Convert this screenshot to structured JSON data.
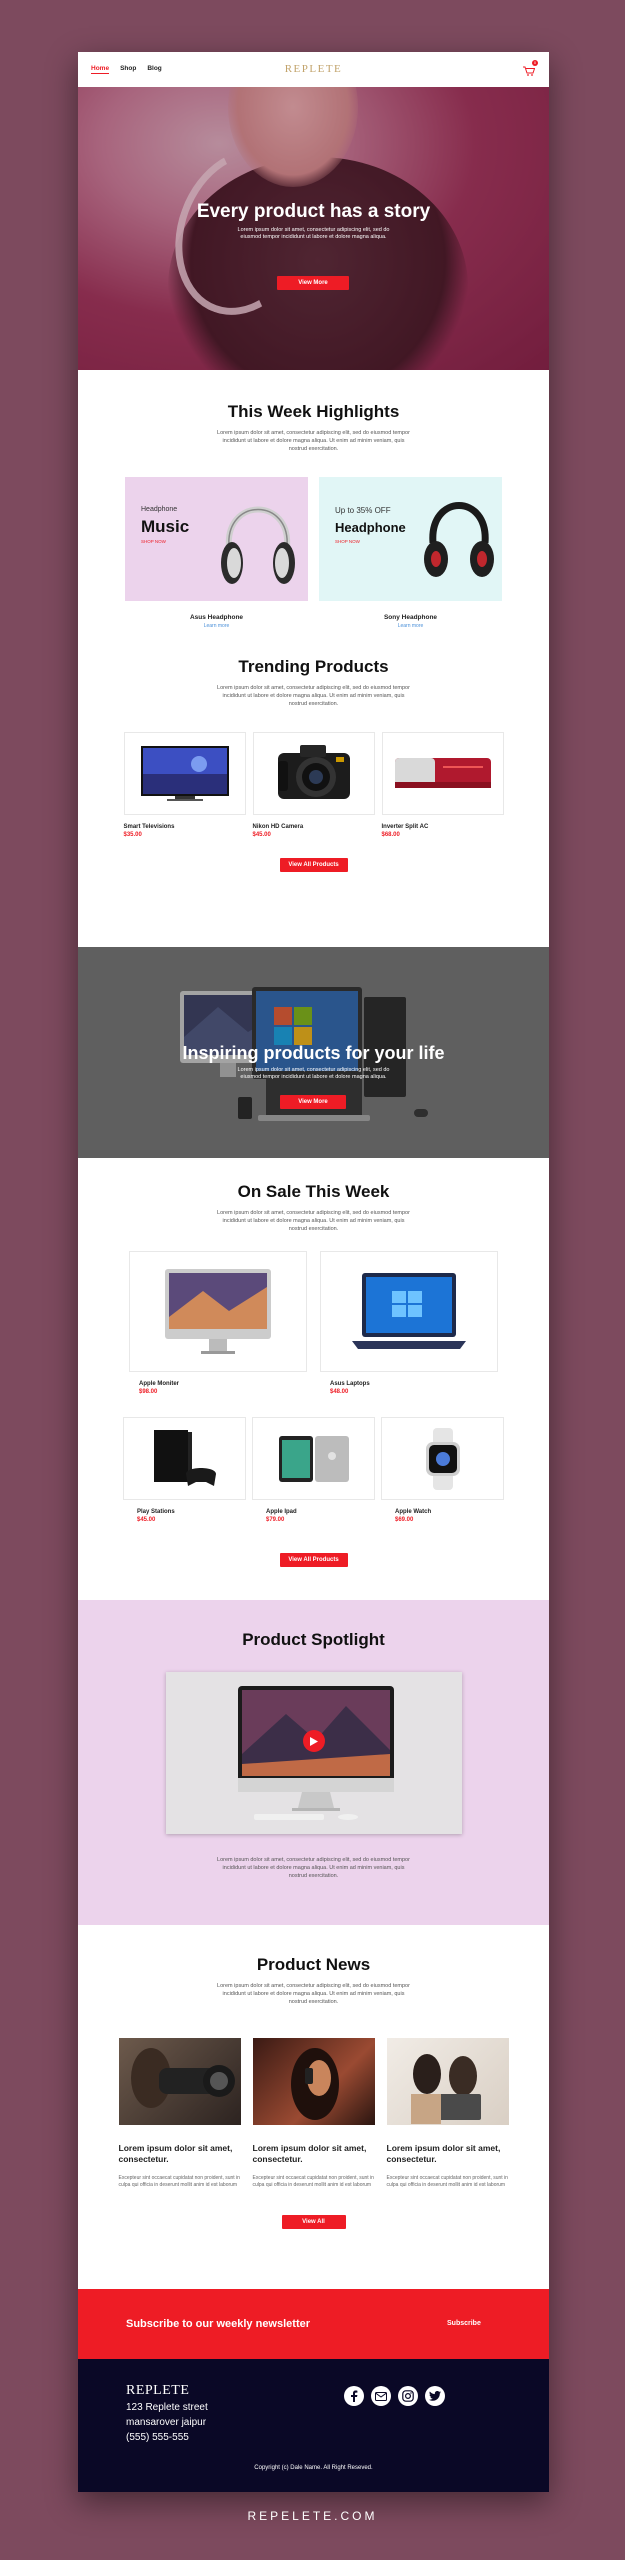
{
  "nav": {
    "links": [
      "Home",
      "Shop",
      "Blog"
    ],
    "logo": "REPLETE",
    "cart_count": "0"
  },
  "hero": {
    "title": "Every product has a story",
    "desc": "Lorem ipsum dolor sit amet, consectetur adipiscing elit, sed do eiusmod tempor incididunt ut labore et dolore magna aliqua.",
    "button": "View More"
  },
  "highlights": {
    "title": "This Week Highlights",
    "desc": "Lorem ipsum dolor sit amet, consectetur adipiscing elit, sed do eiusmod tempor incididunt ut labore et dolore magna aliqua. Ut enim ad minim veniam, quis nostrud exercitation.",
    "cards": [
      {
        "small": "Headphone",
        "big": "Music",
        "shop": "SHOP NOW",
        "name": "Asus Headphone",
        "link": "Learn more",
        "bg": "#ecd3ec"
      },
      {
        "small": "Up to 35% OFF",
        "big": "Headphone",
        "shop": "SHOP NOW",
        "name": "Sony Headphone",
        "link": "Learn more",
        "bg": "#e1f6f6"
      }
    ]
  },
  "trending": {
    "title": "Trending Products",
    "desc": "Lorem ipsum dolor sit amet, consectetur adipiscing elit, sed do eiusmod tempor incididunt ut labore et dolore magna aliqua. Ut enim ad minim veniam, quis nostrud exercitation.",
    "items": [
      {
        "name": "Smart Televisions",
        "price": "$35.00"
      },
      {
        "name": "Nikon HD Camera",
        "price": "$45.00"
      },
      {
        "name": "Inverter Split AC",
        "price": "$68.00"
      }
    ],
    "button": "View All Products"
  },
  "inspire": {
    "title": "Inspiring products for your life",
    "desc": "Lorem ipsum dolor sit amet, consectetur adipiscing elit, sed do eiusmod tempor incididunt ut labore et dolore magna aliqua.",
    "button": "View More"
  },
  "sale": {
    "title": "On Sale This Week",
    "desc": "Lorem ipsum dolor sit amet, consectetur adipiscing elit, sed do eiusmod tempor incididunt ut labore et dolore magna aliqua. Ut enim ad minim veniam, quis nostrud exercitation.",
    "big": [
      {
        "name": "Apple Moniter",
        "price": "$98.00"
      },
      {
        "name": "Asus Laptops",
        "price": "$48.00"
      }
    ],
    "small": [
      {
        "name": "Play Stations",
        "price": "$45.00"
      },
      {
        "name": "Apple Ipad",
        "price": "$79.00"
      },
      {
        "name": "Apple Watch",
        "price": "$69.00"
      }
    ],
    "button": "View All Products"
  },
  "spotlight": {
    "title": "Product Spotlight",
    "desc": "Lorem ipsum dolor sit amet, consectetur adipiscing elit, sed do eiusmod tempor incididunt ut labore et dolore magna aliqua. Ut enim ad minim veniam, quis nostrud exercitation."
  },
  "news": {
    "title": "Product News",
    "desc": "Lorem ipsum dolor sit amet, consectetur adipiscing elit, sed do eiusmod tempor incididunt ut labore et dolore magna aliqua. Ut enim ad minim veniam, quis nostrud exercitation.",
    "items": [
      {
        "title": "Lorem ipsum dolor sit amet, consectetur.",
        "text": "Excepteur sint occaecat cupidatat non proident, sunt in culpa qui officia in deserunt mollit anim id est laborum"
      },
      {
        "title": "Lorem ipsum dolor sit amet, consectetur.",
        "text": "Excepteur sint occaecat cupidatat non proident, sunt in culpa qui officia in deserunt mollit anim id est laborum"
      },
      {
        "title": "Lorem ipsum dolor sit amet, consectetur.",
        "text": "Excepteur sint occaecat cupidatat non proident, sunt in culpa qui officia in deserunt mollit anim id est laborum"
      }
    ],
    "button": "View All"
  },
  "newsletter": {
    "title": "Subscribe to our weekly newsletter",
    "button": "Subscribe"
  },
  "footer": {
    "logo": "REPLETE",
    "address": [
      "123 Replete street",
      "mansarover jaipur",
      "(555) 555-555"
    ],
    "social": [
      "facebook-icon",
      "mail-icon",
      "instagram-icon",
      "twitter-icon"
    ],
    "copyright": "Copyright (c) Dale Name. All Right Reseved."
  },
  "site_url": "REPELETE.COM",
  "colors": {
    "accent": "#ee1c25",
    "frame": "#7d4a5e",
    "footer": "#0a0826",
    "spotlight": "#ecd3ec"
  }
}
